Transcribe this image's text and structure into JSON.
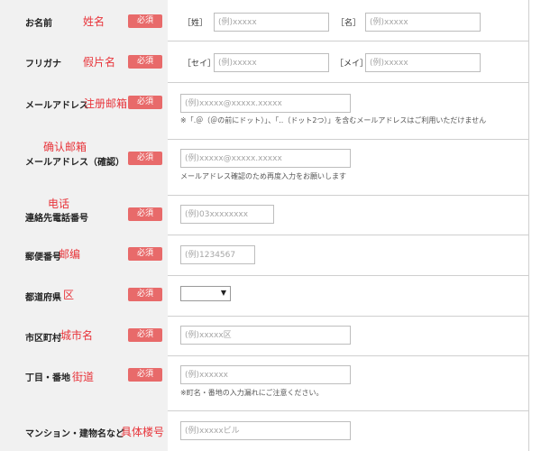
{
  "required_label": "必須",
  "rows": [
    {
      "label": "お名前",
      "annotation": "姓名",
      "bracket1": "［姓］",
      "placeholder1": "(例)xxxxx",
      "bracket2": "［名］",
      "placeholder2": "(例)xxxxx"
    },
    {
      "label": "フリガナ",
      "annotation": "假片名",
      "bracket1": "［セイ］",
      "placeholder1": "(例)xxxxx",
      "bracket2": "［メイ］",
      "placeholder2": "(例)xxxxx"
    },
    {
      "label": "メールアドレス",
      "annotation": "注册邮箱",
      "placeholder": "(例)xxxxx@xxxxx.xxxxx",
      "note": "※「.＠（＠の前にドット）」、「..（ドット2つ）」を含むメールアドレスはご利用いただけません"
    },
    {
      "label": "メールアドレス（確認）",
      "annotation": "确认邮箱",
      "placeholder": "(例)xxxxx@xxxxx.xxxxx",
      "note": "メールアドレス確認のため再度入力をお願いします"
    },
    {
      "label": "連絡先電話番号",
      "annotation": "电话",
      "placeholder": "(例)03xxxxxxxx"
    },
    {
      "label": "郵便番号",
      "annotation": "邮编",
      "placeholder": "(例)1234567"
    },
    {
      "label": "都道府県",
      "annotation": "区",
      "select_value": ""
    },
    {
      "label": "市区町村",
      "annotation": "城市名",
      "placeholder": "(例)xxxxx区"
    },
    {
      "label": "丁目・番地",
      "annotation": "街道",
      "placeholder": "(例)xxxxxx",
      "note": "※町名・番地の入力漏れにご注意ください。"
    },
    {
      "label": "マンション・建物名など",
      "annotation": "具体楼号",
      "placeholder": "(例)xxxxxビル"
    }
  ],
  "icons": {
    "select_arrow": "dropdown-arrow-icon"
  },
  "colors": {
    "required_badge": "#e86a6a",
    "annotation": "#e8343a",
    "label_bg": "#f1f1f1"
  }
}
